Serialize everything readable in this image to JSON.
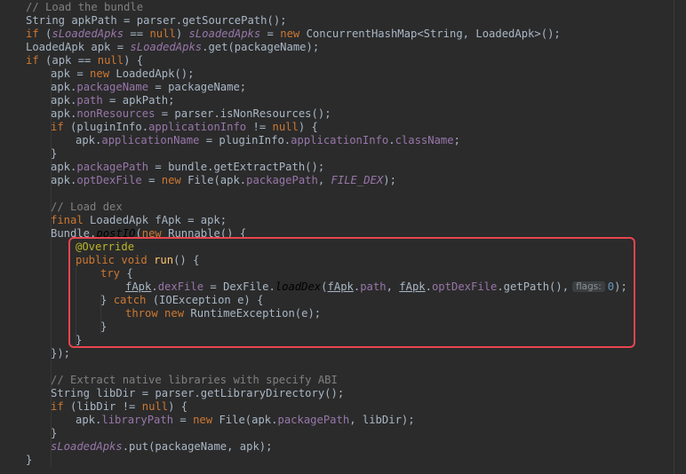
{
  "editor": {
    "lines": [
      {
        "indent": 1,
        "tokens": [
          {
            "t": "// Load the bundle",
            "c": "cmt"
          }
        ]
      },
      {
        "indent": 1,
        "tokens": [
          {
            "t": "String apkPath = parser.getSourcePath();",
            "c": "pl"
          }
        ]
      },
      {
        "indent": 1,
        "tokens": [
          {
            "t": "if",
            "c": "kw"
          },
          {
            "t": " (",
            "c": "pl"
          },
          {
            "t": "sLoadedApks",
            "c": "sfi"
          },
          {
            "t": " == ",
            "c": "pl"
          },
          {
            "t": "null",
            "c": "kw"
          },
          {
            "t": ") ",
            "c": "pl"
          },
          {
            "t": "sLoadedApks",
            "c": "sfi"
          },
          {
            "t": " = ",
            "c": "pl"
          },
          {
            "t": "new",
            "c": "kw"
          },
          {
            "t": " ConcurrentHashMap<String, LoadedApk>();",
            "c": "pl"
          }
        ]
      },
      {
        "indent": 1,
        "tokens": [
          {
            "t": "LoadedApk apk = ",
            "c": "pl"
          },
          {
            "t": "sLoadedApks",
            "c": "sfi"
          },
          {
            "t": ".get(packageName);",
            "c": "pl"
          }
        ]
      },
      {
        "indent": 1,
        "tokens": [
          {
            "t": "if",
            "c": "kw"
          },
          {
            "t": " (apk == ",
            "c": "pl"
          },
          {
            "t": "null",
            "c": "kw"
          },
          {
            "t": ") {",
            "c": "pl"
          }
        ]
      },
      {
        "indent": 2,
        "tokens": [
          {
            "t": "apk = ",
            "c": "pl"
          },
          {
            "t": "new",
            "c": "kw"
          },
          {
            "t": " LoadedApk();",
            "c": "pl"
          }
        ]
      },
      {
        "indent": 2,
        "tokens": [
          {
            "t": "apk.",
            "c": "pl"
          },
          {
            "t": "packageName",
            "c": "fld"
          },
          {
            "t": " = packageName;",
            "c": "pl"
          }
        ]
      },
      {
        "indent": 2,
        "tokens": [
          {
            "t": "apk.",
            "c": "pl"
          },
          {
            "t": "path",
            "c": "fld"
          },
          {
            "t": " = apkPath;",
            "c": "pl"
          }
        ]
      },
      {
        "indent": 2,
        "tokens": [
          {
            "t": "apk.",
            "c": "pl"
          },
          {
            "t": "nonResources",
            "c": "fld"
          },
          {
            "t": " = parser.isNonResources();",
            "c": "pl"
          }
        ]
      },
      {
        "indent": 2,
        "tokens": [
          {
            "t": "if",
            "c": "kw"
          },
          {
            "t": " (pluginInfo.",
            "c": "pl"
          },
          {
            "t": "applicationInfo",
            "c": "fld"
          },
          {
            "t": " != ",
            "c": "pl"
          },
          {
            "t": "null",
            "c": "kw"
          },
          {
            "t": ") {",
            "c": "pl"
          }
        ]
      },
      {
        "indent": 3,
        "tokens": [
          {
            "t": "apk.",
            "c": "pl"
          },
          {
            "t": "applicationName",
            "c": "fld"
          },
          {
            "t": " = pluginInfo.",
            "c": "pl"
          },
          {
            "t": "applicationInfo",
            "c": "fld"
          },
          {
            "t": ".",
            "c": "pl"
          },
          {
            "t": "className",
            "c": "fld"
          },
          {
            "t": ";",
            "c": "pl"
          }
        ]
      },
      {
        "indent": 2,
        "tokens": [
          {
            "t": "}",
            "c": "pl"
          }
        ]
      },
      {
        "indent": 2,
        "tokens": [
          {
            "t": "apk.",
            "c": "pl"
          },
          {
            "t": "packagePath",
            "c": "fld"
          },
          {
            "t": " = bundle.getExtractPath();",
            "c": "pl"
          }
        ]
      },
      {
        "indent": 2,
        "tokens": [
          {
            "t": "apk.",
            "c": "pl"
          },
          {
            "t": "optDexFile",
            "c": "fld"
          },
          {
            "t": " = ",
            "c": "pl"
          },
          {
            "t": "new",
            "c": "kw"
          },
          {
            "t": " File(apk.",
            "c": "pl"
          },
          {
            "t": "packagePath",
            "c": "fld"
          },
          {
            "t": ", ",
            "c": "pl"
          },
          {
            "t": "FILE_DEX",
            "c": "cst"
          },
          {
            "t": ");",
            "c": "pl"
          }
        ]
      },
      {
        "indent": 0,
        "tokens": []
      },
      {
        "indent": 2,
        "tokens": [
          {
            "t": "// Load dex",
            "c": "cmt"
          }
        ]
      },
      {
        "indent": 2,
        "tokens": [
          {
            "t": "final",
            "c": "kw"
          },
          {
            "t": " LoadedApk fApk = apk;",
            "c": "pl"
          }
        ]
      },
      {
        "indent": 2,
        "tokens": [
          {
            "t": "Bundle.",
            "c": "pl"
          },
          {
            "t": "postIO",
            "c": "it"
          },
          {
            "t": "(",
            "c": "pl"
          },
          {
            "t": "new",
            "c": "kw"
          },
          {
            "t": " Runnable() {",
            "c": "pl"
          }
        ]
      },
      {
        "indent": 3,
        "tokens": [
          {
            "t": "@Override",
            "c": "ann"
          }
        ]
      },
      {
        "indent": 3,
        "tokens": [
          {
            "t": "public",
            "c": "kw"
          },
          {
            "t": " ",
            "c": "pl"
          },
          {
            "t": "void",
            "c": "kw"
          },
          {
            "t": " ",
            "c": "pl"
          },
          {
            "t": "run",
            "c": "fn"
          },
          {
            "t": "() {",
            "c": "pl"
          }
        ]
      },
      {
        "indent": 4,
        "tokens": [
          {
            "t": "try",
            "c": "kw"
          },
          {
            "t": " {",
            "c": "pl"
          }
        ]
      },
      {
        "indent": 5,
        "tokens": [
          {
            "t": "fApk",
            "c": "cap"
          },
          {
            "t": ".",
            "c": "pl"
          },
          {
            "t": "dexFile",
            "c": "fld"
          },
          {
            "t": " = DexFile.",
            "c": "pl"
          },
          {
            "t": "loadDex",
            "c": "it"
          },
          {
            "t": "(",
            "c": "pl"
          },
          {
            "t": "fApk",
            "c": "cap"
          },
          {
            "t": ".",
            "c": "pl"
          },
          {
            "t": "path",
            "c": "fld"
          },
          {
            "t": ", ",
            "c": "pl"
          },
          {
            "t": "fApk",
            "c": "cap"
          },
          {
            "t": ".",
            "c": "pl"
          },
          {
            "t": "optDexFile",
            "c": "fld"
          },
          {
            "t": ".getPath(),",
            "c": "pl"
          },
          {
            "t": "flags:",
            "c": "hint"
          },
          {
            "t": "0",
            "c": "num"
          },
          {
            "t": ");",
            "c": "pl"
          }
        ]
      },
      {
        "indent": 4,
        "tokens": [
          {
            "t": "} ",
            "c": "pl"
          },
          {
            "t": "catch",
            "c": "kw"
          },
          {
            "t": " (IOException e) {",
            "c": "pl"
          }
        ]
      },
      {
        "indent": 5,
        "tokens": [
          {
            "t": "throw",
            "c": "kw"
          },
          {
            "t": " ",
            "c": "pl"
          },
          {
            "t": "new",
            "c": "kw"
          },
          {
            "t": " RuntimeException(e);",
            "c": "pl"
          }
        ]
      },
      {
        "indent": 4,
        "tokens": [
          {
            "t": "}",
            "c": "pl"
          }
        ]
      },
      {
        "indent": 3,
        "tokens": [
          {
            "t": "}",
            "c": "pl"
          }
        ]
      },
      {
        "indent": 2,
        "tokens": [
          {
            "t": "});",
            "c": "pl"
          }
        ]
      },
      {
        "indent": 0,
        "tokens": []
      },
      {
        "indent": 2,
        "tokens": [
          {
            "t": "// Extract native libraries with specify ABI",
            "c": "cmt"
          }
        ]
      },
      {
        "indent": 2,
        "tokens": [
          {
            "t": "String libDir = parser.getLibraryDirectory();",
            "c": "pl"
          }
        ]
      },
      {
        "indent": 2,
        "tokens": [
          {
            "t": "if",
            "c": "kw"
          },
          {
            "t": " (libDir != ",
            "c": "pl"
          },
          {
            "t": "null",
            "c": "kw"
          },
          {
            "t": ") {",
            "c": "pl"
          }
        ]
      },
      {
        "indent": 3,
        "tokens": [
          {
            "t": "apk.",
            "c": "pl"
          },
          {
            "t": "libraryPath",
            "c": "fld"
          },
          {
            "t": " = ",
            "c": "pl"
          },
          {
            "t": "new",
            "c": "kw"
          },
          {
            "t": " File(apk.",
            "c": "pl"
          },
          {
            "t": "packagePath",
            "c": "fld"
          },
          {
            "t": ", libDir);",
            "c": "pl"
          }
        ]
      },
      {
        "indent": 2,
        "tokens": [
          {
            "t": "}",
            "c": "pl"
          }
        ]
      },
      {
        "indent": 2,
        "tokens": [
          {
            "t": "sLoadedApks",
            "c": "sfi"
          },
          {
            "t": ".put(packageName, apk);",
            "c": "pl"
          }
        ]
      },
      {
        "indent": 1,
        "tokens": [
          {
            "t": "}",
            "c": "pl"
          }
        ]
      }
    ],
    "highlight": {
      "label": "highlighted-run-method",
      "color": "#e8454f"
    },
    "colors": {
      "background": "#2b2b2b",
      "keyword": "#cc7832",
      "field": "#9876aa",
      "comment": "#808080",
      "number": "#6897bb",
      "annotation": "#bbb529",
      "method_declaration": "#ffc66d",
      "plain": "#a9b7c6"
    }
  }
}
